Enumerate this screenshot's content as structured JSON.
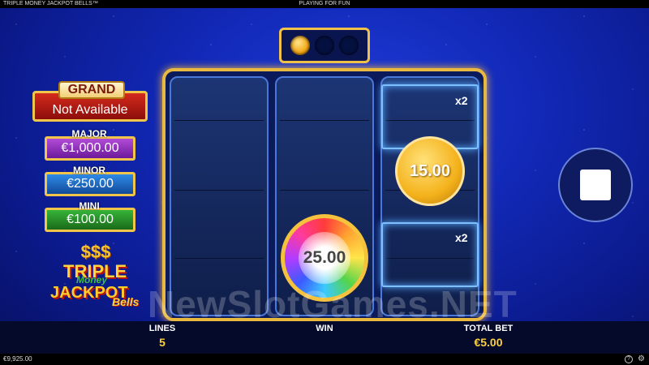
{
  "header": {
    "game_title": "TRIPLE MONEY JACKPOT BELLS™",
    "mode": "PLAYING FOR FUN"
  },
  "progress": {
    "collected": 1,
    "total": 3
  },
  "jackpots": {
    "grand": {
      "label": "GRAND",
      "value": "Not Available"
    },
    "major": {
      "label": "MAJOR",
      "value": "€1,000.00"
    },
    "minor": {
      "label": "MINOR",
      "value": "€250.00"
    },
    "mini": {
      "label": "MINI",
      "value": "€100.00"
    }
  },
  "logo": {
    "symbols": "$$$",
    "line1": "TRIPLE",
    "line2": "Money",
    "line3": "JACKPOT",
    "line4": "Bells"
  },
  "reels": {
    "multiplier_top": "x2",
    "multiplier_bottom": "x2",
    "gold_coin_value": "15.00",
    "rainbow_coin_value": "25.00"
  },
  "watermark": "NewSlotGames.NET",
  "stats": {
    "lines_label": "LINES",
    "lines_value": "5",
    "win_label": "WIN",
    "win_value": "",
    "total_bet_label": "TOTAL BET",
    "total_bet_value": "€5.00"
  },
  "footer": {
    "balance": "€9,925.00",
    "help_icon": "?",
    "settings_icon": "⚙"
  }
}
